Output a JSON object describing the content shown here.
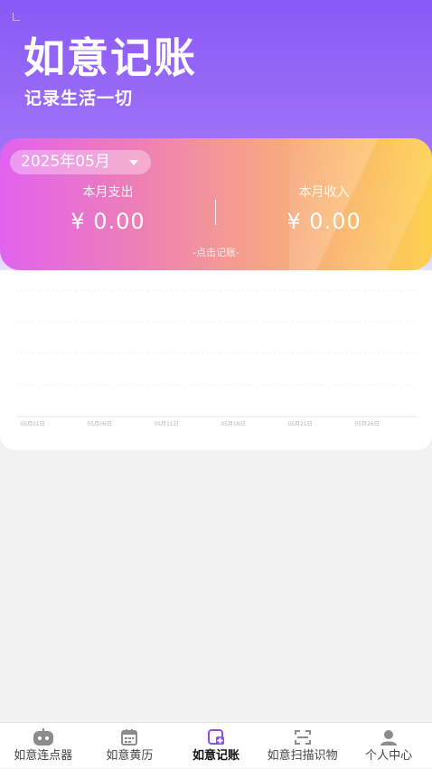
{
  "header": {
    "title": "如意记账",
    "subtitle": "记录生活一切"
  },
  "summary": {
    "month": "2025年05月",
    "expense_label": "本月支出",
    "expense_value": "¥  0.00",
    "income_label": "本月收入",
    "income_value": "¥  0.00",
    "record_hint": "-点击记账-"
  },
  "chart_data": {
    "type": "line",
    "categories": [
      "05月01日",
      "05月06日",
      "05月11日",
      "05月16日",
      "05月21日",
      "05月26日"
    ],
    "series": [
      {
        "values": [
          0,
          0,
          0,
          0,
          0,
          0
        ]
      }
    ],
    "grid": true
  },
  "tabbar": {
    "items": [
      {
        "label": "如意连点器",
        "icon": "robot-icon"
      },
      {
        "label": "如意黄历",
        "icon": "calendar-icon"
      },
      {
        "label": "如意记账",
        "icon": "ledger-icon"
      },
      {
        "label": "如意扫描识物",
        "icon": "scan-icon"
      },
      {
        "label": "个人中心",
        "icon": "user-icon"
      }
    ],
    "active_color": "#8a4ff5",
    "inactive_color": "#9a9a9a"
  },
  "colors": {
    "header_accent": "#8a59f6",
    "card_start": "#e162ef",
    "card_end": "#fcd04e"
  }
}
